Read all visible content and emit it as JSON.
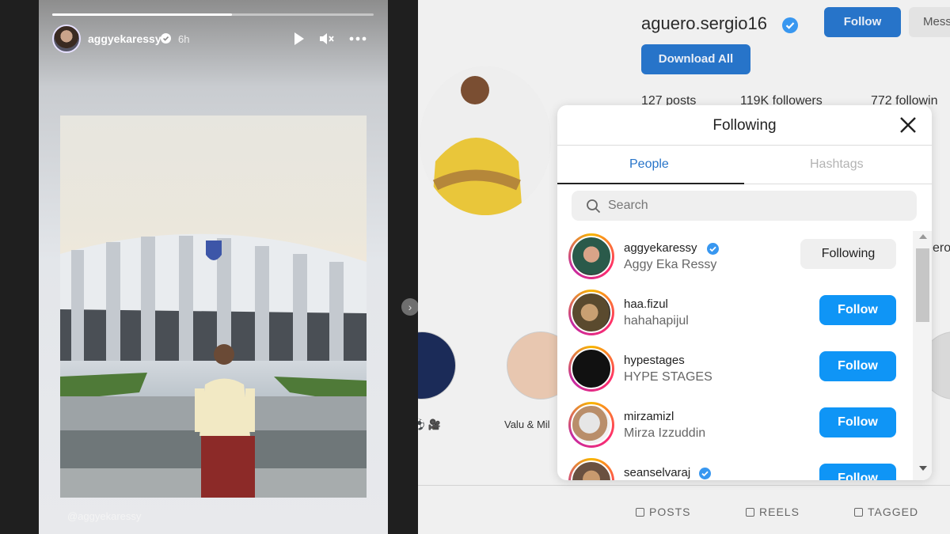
{
  "story": {
    "username": "aggyekaressy",
    "time": "6h",
    "progress": 0.56,
    "mention": "@aggyekaressy",
    "controls": [
      "play-icon",
      "mute-icon",
      "more-icon"
    ]
  },
  "profile": {
    "username": "aguero.sergio16",
    "follow_label": "Follow",
    "message_label": "Mess",
    "download_label": "Download All",
    "stats": [
      "127 posts",
      "119K followers",
      "772 followin"
    ],
    "side_text": "ero",
    "highlight_labels": [
      "o ⚽ 🎥",
      "Valu & Mil"
    ],
    "tabs": [
      "POSTS",
      "REELS",
      "TAGGED"
    ]
  },
  "modal": {
    "title": "Following",
    "tabs": [
      "People",
      "Hashtags"
    ],
    "search_placeholder": "Search",
    "accounts": [
      {
        "username": "aggyekaressy",
        "name": "Aggy Eka Ressy",
        "verified": true,
        "button": "Following"
      },
      {
        "username": "haa.fizul",
        "name": "hahahapijul",
        "verified": false,
        "button": "Follow"
      },
      {
        "username": "hypestages",
        "name": "HYPE STAGES",
        "verified": false,
        "button": "Follow"
      },
      {
        "username": "mirzamizl",
        "name": "Mirza Izzuddin",
        "verified": false,
        "button": "Follow"
      },
      {
        "username": "seanselvaraj",
        "name": "",
        "verified": true,
        "button": "Follow"
      }
    ]
  },
  "colors": {
    "accent": "#0f95f6",
    "verified": "#3897f0",
    "tab_active": "#2774c9"
  }
}
